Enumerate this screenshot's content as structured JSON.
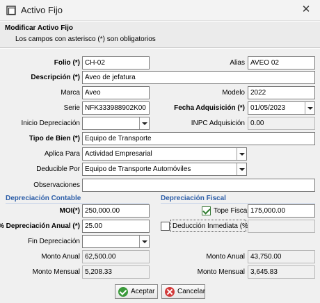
{
  "window": {
    "title": "Activo Fijo",
    "icon": "app-window-icon",
    "close_icon": "close-icon"
  },
  "header": {
    "title": "Modificar Activo Fijo",
    "subtitle": "Los campos con asterisco (*) son obligatorios"
  },
  "form": {
    "folio_label": "Folio (*)",
    "folio_value": "CH-02",
    "alias_label": "Alias",
    "alias_value": "AVEO 02",
    "descripcion_label": "Descripción (*)",
    "descripcion_value": "Aveo de jefatura",
    "marca_label": "Marca",
    "marca_value": "Aveo",
    "modelo_label": "Modelo",
    "modelo_value": "2022",
    "serie_label": "Serie",
    "serie_value": "NFK333988902K00",
    "fecha_label": "Fecha Adquisición (*)",
    "fecha_value": "01/05/2023",
    "inicio_dep_label": "Inicio Depreciación",
    "inicio_dep_value": "",
    "inpc_label": "INPC Adquisición",
    "inpc_value": "0.00",
    "tipo_bien_label": "Tipo de Bien (*)",
    "tipo_bien_value": "Equipo de Transporte",
    "aplica_para_label": "Aplica Para",
    "aplica_para_value": "Actividad Empresarial",
    "deducible_label": "Deducible Por",
    "deducible_value": "Equipo de Transporte Automóviles",
    "observaciones_label": "Observaciones",
    "observaciones_value": ""
  },
  "contable": {
    "section_title": "Depreciación Contable",
    "moi_label": "MOI(*)",
    "moi_value": "250,000.00",
    "porc_label": "% Depreciación Anual (*)",
    "porc_value": "25.00",
    "fin_label": "Fin Depreciación",
    "fin_value": "",
    "anual_label": "Monto Anual",
    "anual_value": "62,500.00",
    "mensual_label": "Monto Mensual",
    "mensual_value": "5,208.33"
  },
  "fiscal": {
    "section_title": "Depreciación Fiscal",
    "tope_label": "Tope Fiscal",
    "tope_checked": true,
    "tope_value": "175,000.00",
    "deduccion_label": "Deducción Inmediata (%)",
    "deduccion_checked": false,
    "deduccion_value": "",
    "anual_label": "Monto Anual",
    "anual_value": "43,750.00",
    "mensual_label": "Monto Mensual",
    "mensual_value": "3,645.83"
  },
  "buttons": {
    "aceptar_label": "Aceptar",
    "cancelar_label": "Cancelar"
  },
  "colors": {
    "section_title": "#2d5ea8",
    "ok_icon": "#3b9a3b",
    "cancel_icon": "#d23a3a"
  }
}
